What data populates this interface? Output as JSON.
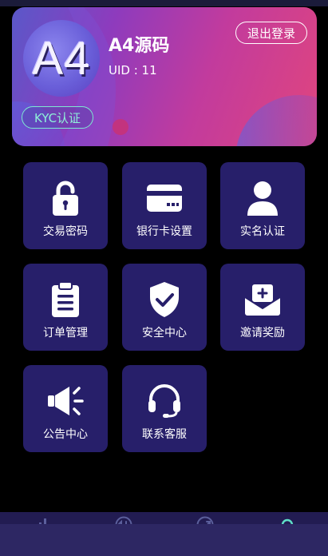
{
  "profile": {
    "avatar_text": "A4",
    "username": "A4源码",
    "uid": "UID : 11",
    "logout_label": "退出登录",
    "kyc_label": "KYC认证"
  },
  "menu": {
    "items": [
      {
        "label": "交易密码",
        "icon": "lock-icon"
      },
      {
        "label": "银行卡设置",
        "icon": "credit-card-icon"
      },
      {
        "label": "实名认证",
        "icon": "user-icon"
      },
      {
        "label": "订单管理",
        "icon": "clipboard-icon"
      },
      {
        "label": "安全中心",
        "icon": "shield-check-icon"
      },
      {
        "label": "邀请奖励",
        "icon": "envelope-plus-icon"
      },
      {
        "label": "公告中心",
        "icon": "megaphone-icon"
      },
      {
        "label": "联系客服",
        "icon": "headset-icon"
      }
    ]
  },
  "bottom_nav": {
    "items": [
      {
        "icon": "bar-chart-icon"
      },
      {
        "icon": "exchange-icon"
      },
      {
        "icon": "trend-icon"
      },
      {
        "icon": "profile-icon"
      }
    ]
  },
  "colors": {
    "tile_bg": "#271f6a",
    "kyc_accent": "#8ef0d8",
    "bottom_bar": "#221c52"
  }
}
